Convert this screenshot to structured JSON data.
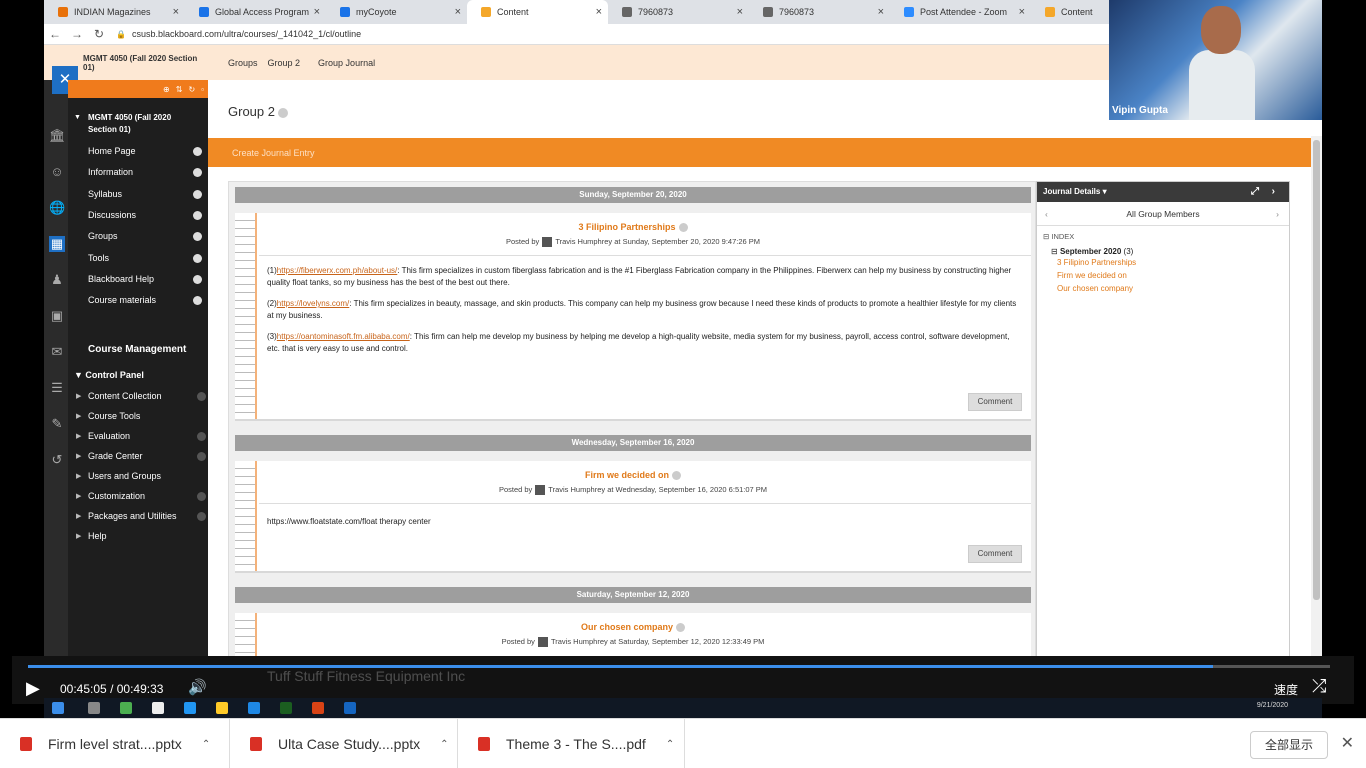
{
  "browser": {
    "tabs": [
      {
        "label": "INDIAN Magazines",
        "color": "#e8710a"
      },
      {
        "label": "Global Access Program (GA",
        "color": "#1a73e8"
      },
      {
        "label": "myCoyote",
        "color": "#1a73e8"
      },
      {
        "label": "Content",
        "color": "#f4a72a"
      },
      {
        "label": "7960873",
        "color": "#666666"
      },
      {
        "label": "7960873",
        "color": "#666666"
      },
      {
        "label": "Post Attendee - Zoom",
        "color": "#2d8cff"
      },
      {
        "label": "Content",
        "color": "#f4a72a"
      }
    ],
    "url": "csusb.blackboard.com/ultra/courses/_141042_1/cl/outline"
  },
  "header": {
    "course_title": "MGMT 4050 (Fall 2020 Section 01)",
    "breadcrumbs": [
      "Groups",
      "Group 2",
      "Group Journal"
    ]
  },
  "course_menu": {
    "title": "MGMT 4050 (Fall 2020 Section 01)",
    "items": [
      "Home Page",
      "Information",
      "Syllabus",
      "Discussions",
      "Groups",
      "Tools",
      "Blackboard Help",
      "Course materials"
    ],
    "management_label": "Course Management",
    "control_panel_label": "Control Panel",
    "control_panel_items": [
      "Content Collection",
      "Course Tools",
      "Evaluation",
      "Grade Center",
      "Users and Groups",
      "Customization",
      "Packages and Utilities",
      "Help"
    ]
  },
  "page": {
    "title": "Group 2",
    "action": "Create Journal Entry"
  },
  "journal": {
    "days": [
      {
        "date": "Sunday, September 20, 2020",
        "title": "3 Filipino Partnerships",
        "posted": "Posted by",
        "author": "Travis Humphrey",
        "time": "at Sunday, September 20, 2020 9:47:26 PM",
        "paras": [
          {
            "prefix": "(1)",
            "link": "https://fiberwerx.com.ph/about-us/",
            "text": ": This firm specializes in custom fiberglass fabrication and is the #1 Fiberglass Fabrication company in the Philippines. Fiberwerx can help my business by constructing higher quality float tanks, so my business has the best of the best out there."
          },
          {
            "prefix": "(2)",
            "link": "https://lovelyns.com/",
            "text": ": This firm specializes in beauty, massage, and skin products. This company can help my business grow because I need these kinds of products to promote a healthier lifestyle for my clients at my business."
          },
          {
            "prefix": "(3)",
            "link": "https://oantominasoft.fm.alibaba.com/",
            "text": ": This firm can help me develop my business by helping me develop a high-quality website, media system for my business, payroll, access control, software development, etc. that is very easy to use and control."
          }
        ],
        "comment": "Comment"
      },
      {
        "date": "Wednesday, September 16, 2020",
        "title": "Firm we decided on",
        "posted": "Posted by",
        "author": "Travis Humphrey",
        "time": "at Wednesday, September 16, 2020 6:51:07 PM",
        "body": "https://www.floatstate.com/float therapy center",
        "comment": "Comment"
      },
      {
        "date": "Saturday, September 12, 2020",
        "title": "Our chosen company",
        "posted": "Posted by",
        "author": "Travis Humphrey",
        "time": "at Saturday, September 12, 2020 12:33:49 PM"
      }
    ]
  },
  "details": {
    "header": "Journal Details",
    "members": "All Group Members",
    "index": "INDEX",
    "month": "September 2020",
    "count": "(3)",
    "links": [
      "3 Filipino Partnerships",
      "Firm we decided on",
      "Our chosen company"
    ]
  },
  "zoom": {
    "participant": "Vipin Gupta"
  },
  "player": {
    "current": "00:45:05",
    "separator": "/",
    "duration": "00:49:33",
    "progress": 0.91,
    "ghost_text": "Tuff Stuff Fitness Equipment Inc",
    "speed": "速度"
  },
  "taskbar": {
    "date": "9/21/2020"
  },
  "downloads": {
    "files": [
      "Firm level strat....pptx",
      "Ulta Case Study....pptx",
      "Theme 3 - The S....pdf"
    ],
    "show_all": "全部显示"
  }
}
